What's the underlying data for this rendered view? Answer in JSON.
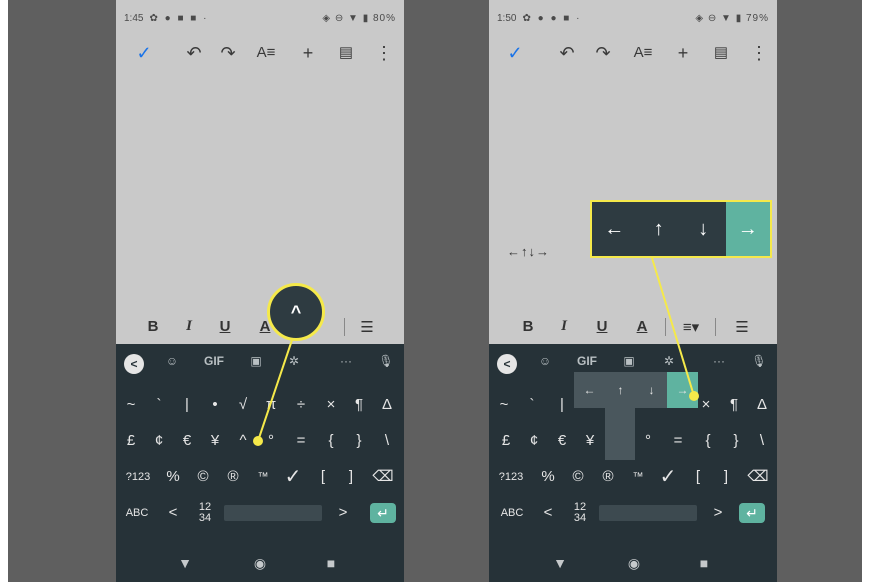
{
  "left_phone": {
    "status": {
      "time": "1:45",
      "battery": "80%"
    },
    "format_bar": {
      "bold": "B",
      "italic": "I",
      "underline": "U",
      "text_color": "A",
      "list": "☰"
    },
    "keyboard": {
      "top_row": {
        "back": "<",
        "gif": "GIF",
        "more": "···"
      },
      "row1": [
        "~",
        "`",
        "|",
        "•",
        "√",
        "π",
        "÷",
        "×",
        "¶",
        "Δ"
      ],
      "row2": [
        "£",
        "¢",
        "€",
        "¥",
        "^",
        "°",
        "=",
        "{",
        "}",
        "\\"
      ],
      "row3": [
        "?123",
        "%",
        "©",
        "®",
        "™",
        "✓",
        "[",
        "]",
        "⌫"
      ],
      "row4": {
        "abc": "ABC",
        "lt": "<",
        "fraction": "12\n34",
        "gt": ">",
        "enter": "↵"
      }
    },
    "callout": "^"
  },
  "right_phone": {
    "status": {
      "time": "1:50",
      "battery": "79%"
    },
    "document_text": "←↑↓→",
    "format_bar": {
      "bold": "B",
      "italic": "I",
      "underline": "U",
      "text_color": "A",
      "align": "≡▾",
      "list": "☰"
    },
    "keyboard": {
      "top_row": {
        "back": "<",
        "gif": "GIF",
        "more": "···"
      },
      "row1_visible": [
        "~",
        "`",
        "|",
        "×",
        "¶",
        "Δ"
      ],
      "row2_visible": [
        "£",
        "¢",
        "€",
        "¥",
        "°",
        "=",
        "{",
        "}",
        "\\"
      ],
      "row3": [
        "?123",
        "%",
        "©",
        "®",
        "™",
        "✓",
        "[",
        "]",
        "⌫"
      ],
      "row4": {
        "abc": "ABC",
        "lt": "<",
        "fraction": "12\n34",
        "gt": ">",
        "enter": "↵"
      },
      "popup": [
        "←",
        "↑",
        "↓",
        "→"
      ]
    },
    "callout": [
      "←",
      "↑",
      "↓",
      "→"
    ]
  },
  "colors": {
    "highlight": "#f5e94a",
    "keyboard_bg": "#263238",
    "accent_teal": "#5fb3a0",
    "check_blue": "#1a73e8"
  }
}
